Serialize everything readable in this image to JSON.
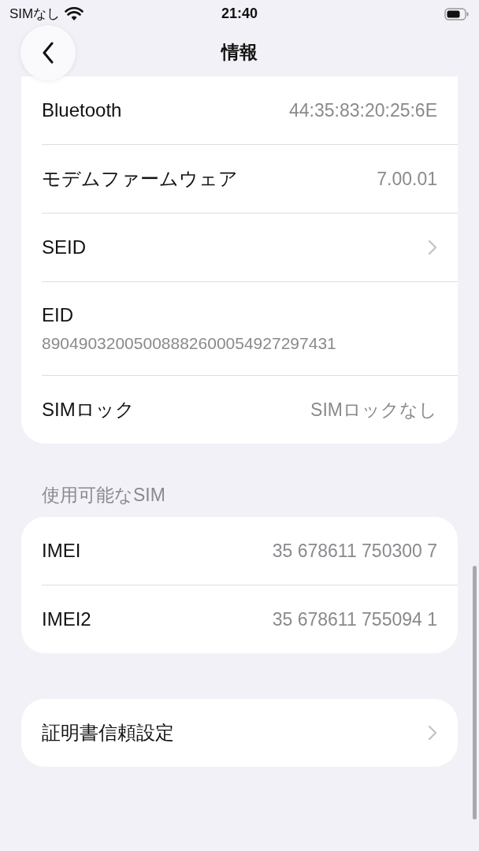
{
  "status_bar": {
    "carrier": "SIMなし",
    "time": "21:40"
  },
  "nav": {
    "title": "情報"
  },
  "groups": [
    {
      "rows": [
        {
          "kind": "value",
          "label": "Bluetooth",
          "value": "44:35:83:20:25:6E"
        },
        {
          "kind": "value",
          "label": "モデムファームウェア",
          "value": "7.00.01"
        },
        {
          "kind": "link",
          "label": "SEID"
        },
        {
          "kind": "stacked",
          "label": "EID",
          "value": "89049032005008882600054927297431"
        },
        {
          "kind": "value",
          "label": "SIMロック",
          "value": "SIMロックなし"
        }
      ]
    },
    {
      "header": "使用可能なSIM",
      "rows": [
        {
          "kind": "value",
          "label": "IMEI",
          "value": "35 678611 750300 7"
        },
        {
          "kind": "value",
          "label": "IMEI2",
          "value": "35 678611 755094 1"
        }
      ]
    },
    {
      "rows": [
        {
          "kind": "link",
          "label": "証明書信頼設定"
        }
      ]
    }
  ]
}
